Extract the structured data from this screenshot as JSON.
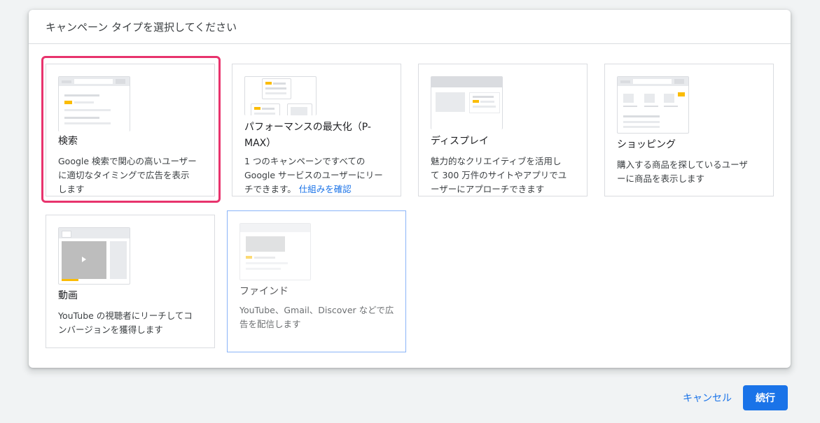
{
  "dialog": {
    "title": "キャンペーン タイプを選択してください"
  },
  "cards": {
    "search": {
      "title": "検索",
      "desc1": "Google 検索で関心の高いユーザー",
      "desc2": "に適切なタイミングで広告を表示",
      "desc3": "します"
    },
    "pmax": {
      "title1": "パフォーマンスの最大化（P-",
      "title2": "MAX）",
      "desc1": "1 つのキャンペーンですべての",
      "desc2": "Google サービスのユーザーにリー",
      "desc3": "チできます。",
      "link": "仕組みを確認"
    },
    "display": {
      "title": "ディスプレイ",
      "desc1": "魅力的なクリエイティブを活用し",
      "desc2": "て 300 万件のサイトやアプリでユ",
      "desc3": "ーザーにアプローチできます"
    },
    "shopping": {
      "title": "ショッピング",
      "desc1": "購入する商品を探しているユーザ",
      "desc2": "ーに商品を表示します"
    },
    "video": {
      "title": "動画",
      "desc1": "YouTube の視聴者にリーチしてコ",
      "desc2": "ンバージョンを獲得します"
    },
    "discovery": {
      "title": "ファインド",
      "desc1": "YouTube、Gmail、Discover などで広",
      "desc2": "告を配信します"
    }
  },
  "footer": {
    "cancel": "キャンセル",
    "continue": "続行"
  },
  "colors": {
    "accent": "#1a73e8",
    "selected": "#e8336d",
    "thumb_highlight": "#fbbc04"
  }
}
